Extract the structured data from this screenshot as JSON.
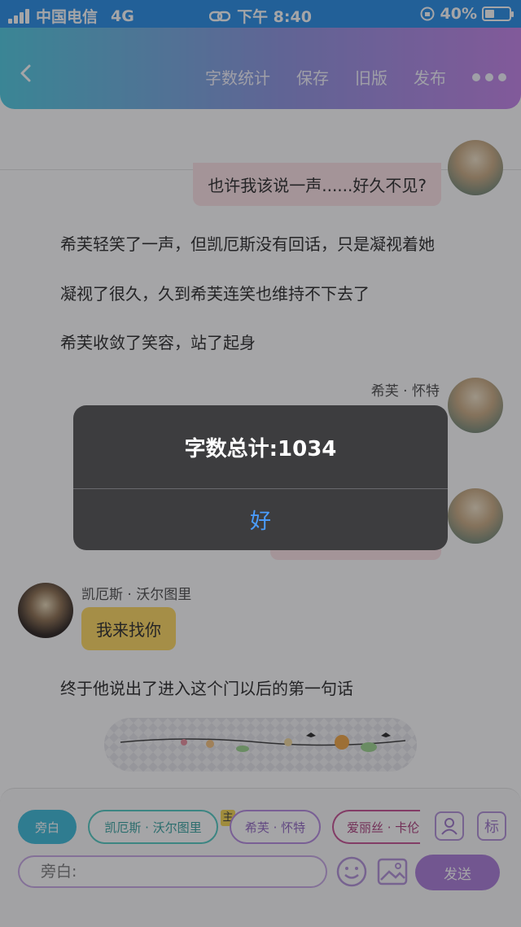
{
  "status_bar": {
    "carrier": "中国电信",
    "network": "4G",
    "time": "下午 8:40",
    "battery_text": "40%",
    "battery_level": 0.4
  },
  "header": {
    "back_icon": "chevron-left-icon",
    "menu": [
      "字数统计",
      "保存",
      "旧版",
      "发布"
    ],
    "more_icon": "more-dots-icon"
  },
  "chat": {
    "message_1": "也许我该说一声......好久不见?",
    "narration_1": "希芙轻笑了一声，但凯厄斯没有回话，只是凝视着她",
    "narration_2": "凝视了很久，久到希芙连笑也维持不下去了",
    "narration_3": "希芙收敛了笑容，站了起身",
    "speaker_hope": "希芙 · 怀特",
    "speaker_caius": "凯厄斯 · 沃尔图里",
    "message_caius": "我来找你",
    "narration_4": "终于他说出了进入这个门以后的第一句话"
  },
  "bottom": {
    "roles": [
      "旁白",
      "凯厄斯 · 沃尔图里",
      "希芙 · 怀特",
      "爱丽丝 · 卡伦"
    ],
    "main_tag": "主",
    "role_manage_icon": "person-card-icon",
    "tag_button": "标",
    "input_placeholder": "旁白:",
    "emoji_icon": "smiley-icon",
    "image_icon": "image-icon",
    "send": "发送"
  },
  "alert": {
    "message": "字数总计:1034",
    "ok": "好"
  },
  "colors": {
    "header_start": "#48c9e0",
    "header_end": "#c27ee8",
    "status_bar": "#1e88e5",
    "send_button": "#a777d8",
    "alert_button_text": "#4a9dff"
  }
}
